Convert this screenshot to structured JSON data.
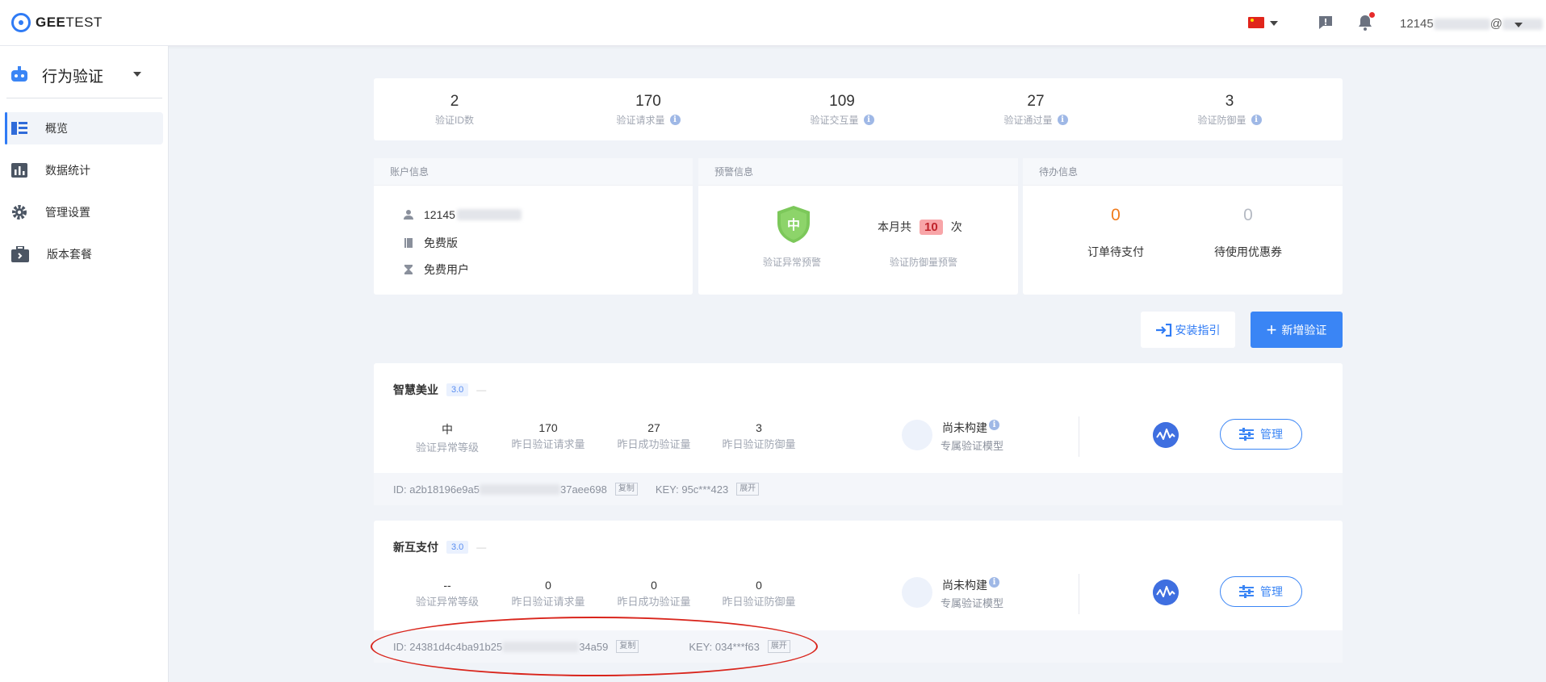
{
  "header": {
    "logo_text_bold": "GEE",
    "logo_text": "TEST",
    "user_prefix": "12145",
    "user_suffix": "@"
  },
  "sidebar": {
    "title": "行为验证",
    "items": [
      {
        "label": "概览",
        "icon": "overview-icon"
      },
      {
        "label": "数据统计",
        "icon": "bar-chart-icon"
      },
      {
        "label": "管理设置",
        "icon": "gear-icon"
      },
      {
        "label": "版本套餐",
        "icon": "briefcase-icon"
      }
    ]
  },
  "stats": [
    {
      "value": "2",
      "label": "验证ID数",
      "info": false
    },
    {
      "value": "170",
      "label": "验证请求量",
      "info": true
    },
    {
      "value": "109",
      "label": "验证交互量",
      "info": true
    },
    {
      "value": "27",
      "label": "验证通过量",
      "info": true
    },
    {
      "value": "3",
      "label": "验证防御量",
      "info": true
    }
  ],
  "account": {
    "header": "账户信息",
    "user_prefix": "12145",
    "edition": "免费版",
    "user_type": "免费用户"
  },
  "alert": {
    "header": "预警信息",
    "shield_text": "中",
    "anomaly_label": "验证异常预警",
    "month_prefix": "本月共",
    "month_count": "10",
    "month_suffix": "次",
    "defense_label": "验证防御量预警"
  },
  "todo": {
    "header": "待办信息",
    "unpaid_count": "0",
    "unpaid_label": "订单待支付",
    "coupon_count": "0",
    "coupon_label": "待使用优惠券"
  },
  "actions": {
    "guide_label": "安装指引",
    "add_label": "新增验证"
  },
  "apps": [
    {
      "name": "智慧美业",
      "version": "3.0",
      "dash": "—",
      "metrics": [
        {
          "value": "中",
          "label": "验证异常等级"
        },
        {
          "value": "170",
          "label": "昨日验证请求量"
        },
        {
          "value": "27",
          "label": "昨日成功验证量"
        },
        {
          "value": "3",
          "label": "昨日验证防御量"
        }
      ],
      "model_status": "尚未构建",
      "model_label": "专属验证模型",
      "manage_label": "管理",
      "id_prefix": "ID: a2b18196e9a5",
      "id_suffix": "37aee698",
      "copy_label": "复制",
      "key_text": "KEY: 95c***423",
      "expand_label": "展开"
    },
    {
      "name": "新互支付",
      "version": "3.0",
      "dash": "—",
      "metrics": [
        {
          "value": "--",
          "label": "验证异常等级"
        },
        {
          "value": "0",
          "label": "昨日验证请求量"
        },
        {
          "value": "0",
          "label": "昨日成功验证量"
        },
        {
          "value": "0",
          "label": "昨日验证防御量"
        }
      ],
      "model_status": "尚未构建",
      "model_label": "专属验证模型",
      "manage_label": "管理",
      "id_prefix": "ID: 24381d4c4ba91b25",
      "id_suffix": "34a59",
      "copy_label": "复制",
      "key_text": "KEY: 034***f63",
      "expand_label": "展开"
    }
  ],
  "colors": {
    "accent": "#2f7bf5",
    "primary_button": "#3a85f5",
    "todo_highlight": "#f07b1c",
    "shield_green": "#7cc85a",
    "annotation_red": "#d9251c"
  }
}
